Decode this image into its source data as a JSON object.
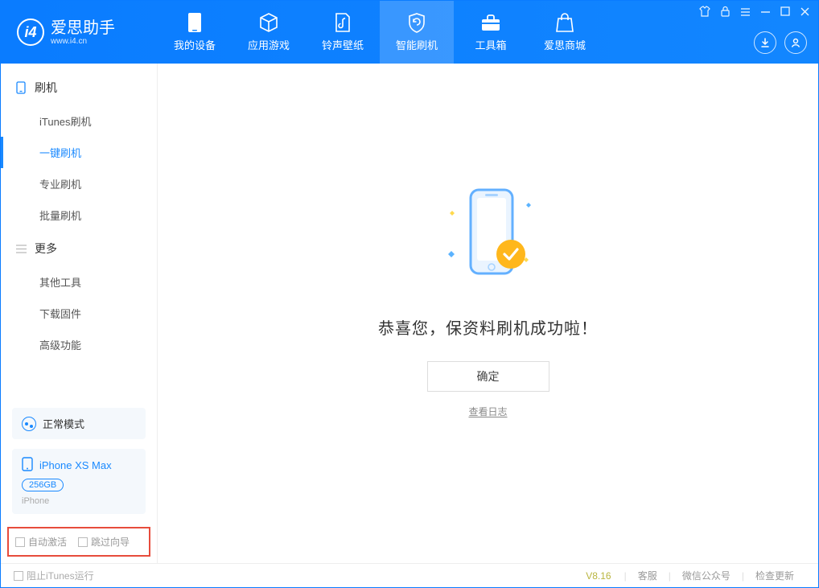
{
  "header": {
    "logo_title": "爱思助手",
    "logo_sub": "www.i4.cn",
    "tabs": [
      {
        "label": "我的设备"
      },
      {
        "label": "应用游戏"
      },
      {
        "label": "铃声壁纸"
      },
      {
        "label": "智能刷机",
        "active": true
      },
      {
        "label": "工具箱"
      },
      {
        "label": "爱思商城"
      }
    ]
  },
  "sidebar": {
    "sec1_title": "刷机",
    "sec1_items": [
      {
        "label": "iTunes刷机"
      },
      {
        "label": "一键刷机",
        "active": true
      },
      {
        "label": "专业刷机"
      },
      {
        "label": "批量刷机"
      }
    ],
    "sec2_title": "更多",
    "sec2_items": [
      {
        "label": "其他工具"
      },
      {
        "label": "下载固件"
      },
      {
        "label": "高级功能"
      }
    ],
    "mode_card": {
      "label": "正常模式"
    },
    "device_card": {
      "name": "iPhone XS Max",
      "capacity": "256GB",
      "type": "iPhone"
    },
    "opt_auto_activate": "自动激活",
    "opt_skip_guide": "跳过向导"
  },
  "main": {
    "success_msg": "恭喜您，保资料刷机成功啦！",
    "ok_btn": "确定",
    "log_link": "查看日志"
  },
  "footer": {
    "block_itunes": "阻止iTunes运行",
    "version": "V8.16",
    "links": [
      "客服",
      "微信公众号",
      "检查更新"
    ]
  }
}
